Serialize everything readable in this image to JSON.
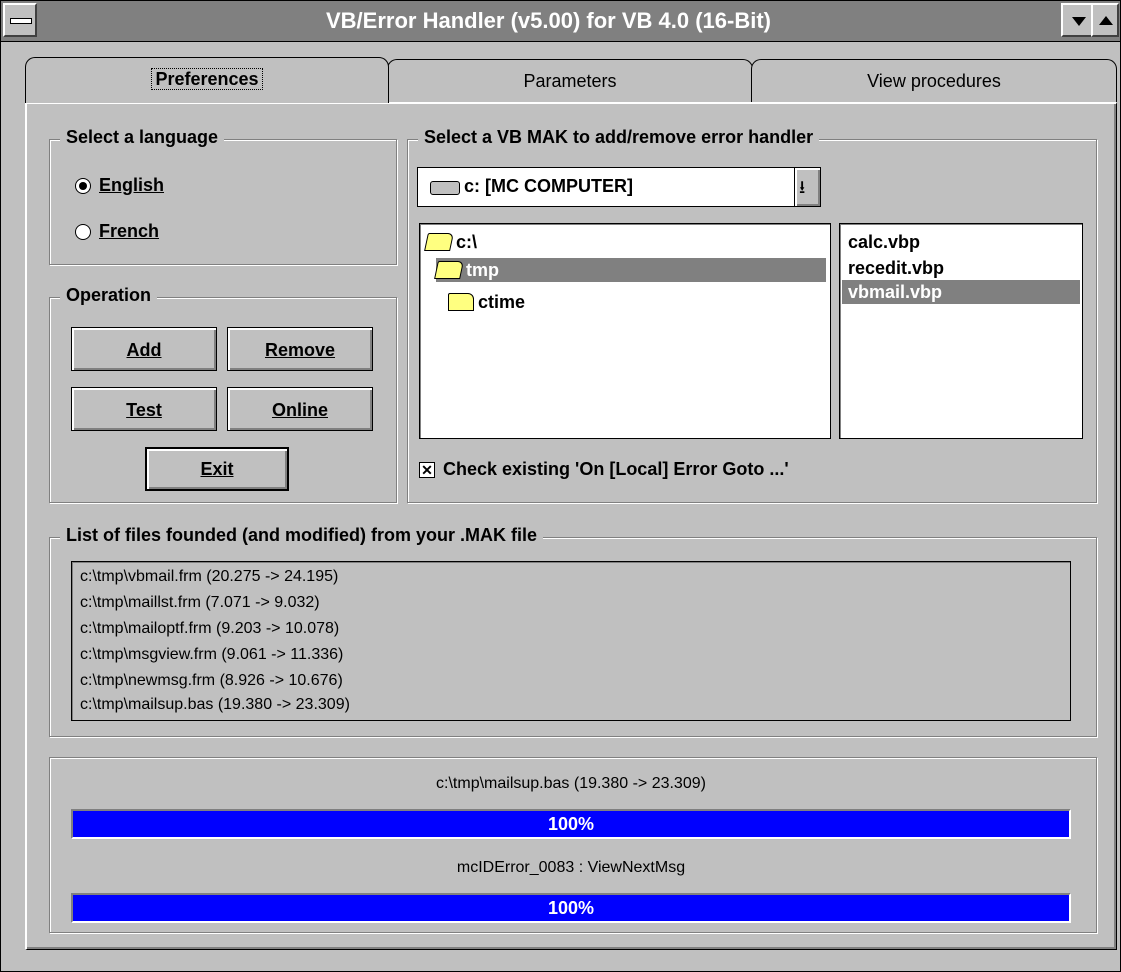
{
  "window": {
    "title": "VB/Error Handler (v5.00) for VB 4.0 (16-Bit)"
  },
  "tabs": [
    {
      "label": "Preferences",
      "active": true
    },
    {
      "label": "Parameters",
      "active": false
    },
    {
      "label": "View procedures",
      "active": false
    }
  ],
  "language": {
    "label": "Select a language",
    "options": [
      {
        "label": "English",
        "selected": true
      },
      {
        "label": "French",
        "selected": false
      }
    ]
  },
  "operation": {
    "label": "Operation",
    "buttons": {
      "add": "Add",
      "remove": "Remove",
      "test": "Test",
      "online": "Online",
      "exit": "Exit"
    }
  },
  "mak": {
    "label": "Select a VB MAK to add/remove error handler",
    "drive": "c: [MC COMPUTER]",
    "directories": [
      {
        "name": "c:\\",
        "selected": false
      },
      {
        "name": "tmp",
        "selected": true
      },
      {
        "name": "ctime",
        "selected": false
      }
    ],
    "files": [
      {
        "name": "calc.vbp",
        "selected": false
      },
      {
        "name": "recedit.vbp",
        "selected": false
      },
      {
        "name": "vbmail.vbp",
        "selected": true
      }
    ],
    "check_existing": {
      "label": "Check existing 'On [Local] Error Goto ...'",
      "checked": true
    }
  },
  "modified_files": {
    "label": "List of files founded (and modified) from your .MAK file",
    "items": [
      "c:\\tmp\\vbmail.frm (20.275 -> 24.195)",
      "c:\\tmp\\maillst.frm (7.071 -> 9.032)",
      "c:\\tmp\\mailoptf.frm (9.203 -> 10.078)",
      "c:\\tmp\\msgview.frm (9.061 -> 11.336)",
      "c:\\tmp\\newmsg.frm (8.926 -> 10.676)",
      "c:\\tmp\\mailsup.bas (19.380 -> 23.309)"
    ]
  },
  "progress": [
    {
      "label": "c:\\tmp\\mailsup.bas (19.380 -> 23.309)",
      "percent_text": "100%",
      "value": 1.0
    },
    {
      "label": "mcIDError_0083 : ViewNextMsg",
      "percent_text": "100%",
      "value": 1.0
    }
  ],
  "colors": {
    "face": "#c0c0c0",
    "title": "#808080",
    "progress": "#0000ff",
    "selection": "#808080"
  }
}
